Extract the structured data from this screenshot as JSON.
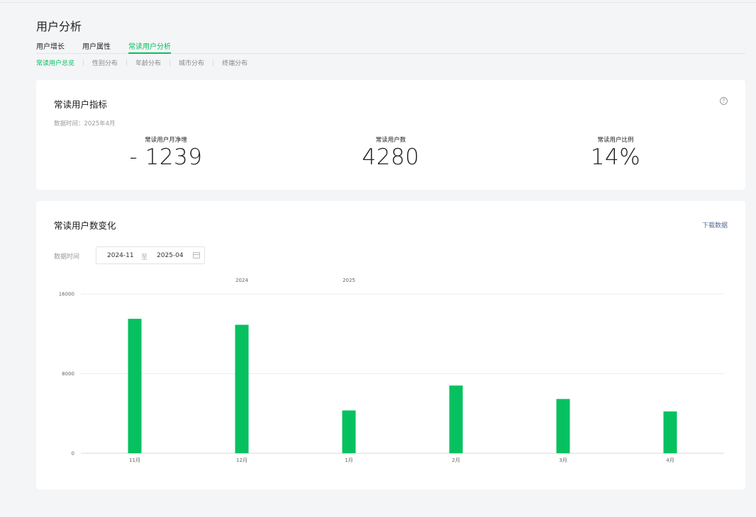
{
  "page": {
    "title": "用户分析",
    "tabs": [
      "用户增长",
      "用户属性",
      "常读用户分析"
    ],
    "subtabs": [
      "常读用户总览",
      "性别分布",
      "年龄分布",
      "城市分布",
      "终端分布"
    ]
  },
  "metrics_card": {
    "title": "常读用户指标",
    "data_time": "数据时间：2025年4月",
    "help_icon": "question-circle-icon",
    "metrics": [
      {
        "label": "常读用户月净增",
        "value": "- 1239"
      },
      {
        "label": "常读用户数",
        "value": "4280"
      },
      {
        "label": "常读用户比例",
        "value": "14%"
      }
    ]
  },
  "trend_card": {
    "title": "常读用户数变化",
    "download": "下载数据",
    "range_label": "数据时间",
    "range_start": "2024-11",
    "range_sep": "至",
    "range_end": "2025-04",
    "calendar_icon": "calendar-icon"
  },
  "chart_data": {
    "type": "bar",
    "categories": [
      "11月",
      "12月",
      "1月",
      "2月",
      "3月",
      "4月"
    ],
    "values": [
      13500,
      12900,
      4300,
      6800,
      5450,
      4200
    ],
    "year_labels": [
      {
        "year": "2024",
        "at_category": "12月"
      },
      {
        "year": "2025",
        "at_category": "1月"
      }
    ],
    "yticks": [
      0,
      8000,
      16000
    ],
    "ylim": [
      0,
      16000
    ],
    "grid": true,
    "bar_color": "#07c160"
  },
  "colors": {
    "accent": "#07c160",
    "link": "#576b95"
  }
}
